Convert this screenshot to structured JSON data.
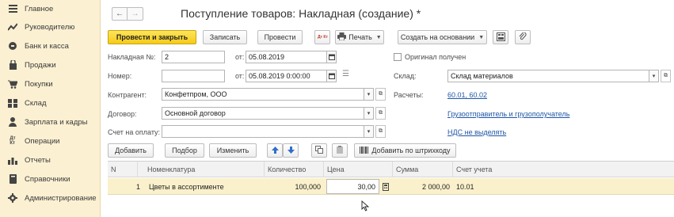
{
  "sidebar": {
    "items": [
      {
        "label": "Главное",
        "icon": "menu-lines-icon"
      },
      {
        "label": "Руководителю",
        "icon": "trend-chart-icon"
      },
      {
        "label": "Банк и касса",
        "icon": "coins-icon"
      },
      {
        "label": "Продажи",
        "icon": "shopping-bag-icon"
      },
      {
        "label": "Покупки",
        "icon": "shopping-cart-icon"
      },
      {
        "label": "Склад",
        "icon": "warehouse-grid-icon"
      },
      {
        "label": "Зарплата и кадры",
        "icon": "person-icon"
      },
      {
        "label": "Операции",
        "icon": "debit-credit-icon"
      },
      {
        "label": "Отчеты",
        "icon": "bar-chart-icon"
      },
      {
        "label": "Справочники",
        "icon": "book-icon"
      },
      {
        "label": "Администрирование",
        "icon": "gear-icon"
      }
    ]
  },
  "header": {
    "back": "←",
    "forward": "→",
    "title": "Поступление товаров: Накладная (создание) *"
  },
  "toolbar": {
    "post_close": "Провести и закрыть",
    "save": "Записать",
    "post": "Провести",
    "print": "Печать",
    "create_based": "Создать на основании",
    "dt_kt": "Дт Кт"
  },
  "form": {
    "invoice_no_label": "Накладная №:",
    "invoice_no_value": "2",
    "from_label": "от:",
    "invoice_date": "05.08.2019",
    "original_received_label": "Оригинал получен",
    "number_label": "Номер:",
    "number_value": "",
    "from_label2": "от:",
    "number_date": "05.08.2019  0:00:00",
    "warehouse_label": "Склад:",
    "warehouse_value": "Склад материалов",
    "counterparty_label": "Контрагент:",
    "counterparty_value": "Конфетпром, ООО",
    "settlements_label": "Расчеты:",
    "settlements_link": "60.01, 60.02",
    "contract_label": "Договор:",
    "contract_value": "Основной договор",
    "shipper_link": "Грузоотправитель и грузополучатель",
    "invoice_for_payment_label": "Счет на оплату:",
    "invoice_for_payment_value": "",
    "vat_link": "НДС не выделять"
  },
  "table_toolbar": {
    "add": "Добавить",
    "select": "Подбор",
    "change": "Изменить",
    "barcode": "Добавить по штрихкоду"
  },
  "table": {
    "columns": [
      "N",
      "Номенклатура",
      "Количество",
      "Цена",
      "Сумма",
      "Счет учета"
    ],
    "rows": [
      {
        "n": "1",
        "item": "Цветы в ассортименте",
        "qty": "100,000",
        "price": "30,00",
        "sum": "2 000,00",
        "account": "10.01"
      }
    ]
  },
  "colors": {
    "sidebar_bg": "#fbf0d2",
    "primary_button": "#f5cb1a",
    "link": "#1f57a6",
    "selected_row": "#faf1cc"
  }
}
